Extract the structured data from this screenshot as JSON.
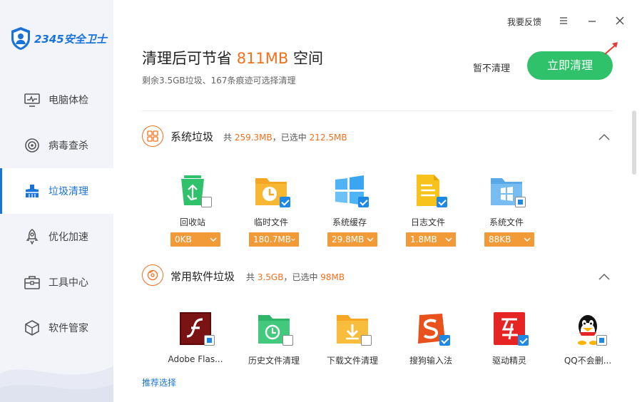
{
  "app": {
    "logo_text": "2345安全卫士",
    "brand_color": "#1a73d9",
    "accent_orange": "#f3701d",
    "success_green": "#2fc26a"
  },
  "sidebar": {
    "items": [
      {
        "label": "电脑体检",
        "icon": "monitor-icon",
        "active": false
      },
      {
        "label": "病毒查杀",
        "icon": "target-icon",
        "active": false
      },
      {
        "label": "垃圾清理",
        "icon": "broom-icon",
        "active": true
      },
      {
        "label": "优化加速",
        "icon": "rocket-icon",
        "active": false
      },
      {
        "label": "工具中心",
        "icon": "toolbox-icon",
        "active": false
      },
      {
        "label": "软件管家",
        "icon": "cube-icon",
        "active": false
      }
    ]
  },
  "topbar": {
    "feedback": "我要反馈",
    "menu_icon": "menu-icon",
    "minimize_icon": "minimize-icon",
    "close_icon": "close-icon"
  },
  "header": {
    "title_prefix": "清理后可节省 ",
    "title_amount": "811MB",
    "title_suffix": " 空间",
    "subtitle": "剩余3.5GB垃圾、167条痕迹可选择清理",
    "later_label": "暂不清理",
    "clean_label": "立即清理"
  },
  "sections": [
    {
      "title": "系统垃圾",
      "icon": "grid-icon",
      "meta_prefix": "共 ",
      "meta_total": "259.3MB",
      "meta_mid": "，已选中 ",
      "meta_selected": "212.5MB",
      "items": [
        {
          "label": "回收站",
          "size": "0KB",
          "icon": "recycle-bin-icon",
          "check": "off"
        },
        {
          "label": "临时文件",
          "size": "180.7MB",
          "icon": "clock-folder-icon",
          "check": "on"
        },
        {
          "label": "系统缓存",
          "size": "29.8MB",
          "icon": "windows-icon",
          "check": "on"
        },
        {
          "label": "日志文件",
          "size": "1.8MB",
          "icon": "log-file-icon",
          "check": "on"
        },
        {
          "label": "系统文件",
          "size": "88KB",
          "icon": "windows-folder-icon",
          "check": "partial"
        }
      ]
    },
    {
      "title": "常用软件垃圾",
      "icon": "disc-icon",
      "meta_prefix": "共 ",
      "meta_total": "3.5GB",
      "meta_mid": "，已选中 ",
      "meta_selected": "98MB",
      "items": [
        {
          "label": "Adobe Flas...",
          "icon": "flash-icon",
          "check": "partial"
        },
        {
          "label": "历史文件清理",
          "icon": "history-folder-icon",
          "check": "off"
        },
        {
          "label": "下载文件清理",
          "icon": "download-folder-icon",
          "check": "off"
        },
        {
          "label": "搜狗输入法",
          "icon": "sogou-icon",
          "check": "on"
        },
        {
          "label": "驱动精灵",
          "icon": "driver-genius-icon",
          "check": "on"
        },
        {
          "label": "QQ不会删...",
          "icon": "qq-icon",
          "check": "partial"
        }
      ]
    }
  ],
  "footer": {
    "recommend": "推荐选择"
  }
}
